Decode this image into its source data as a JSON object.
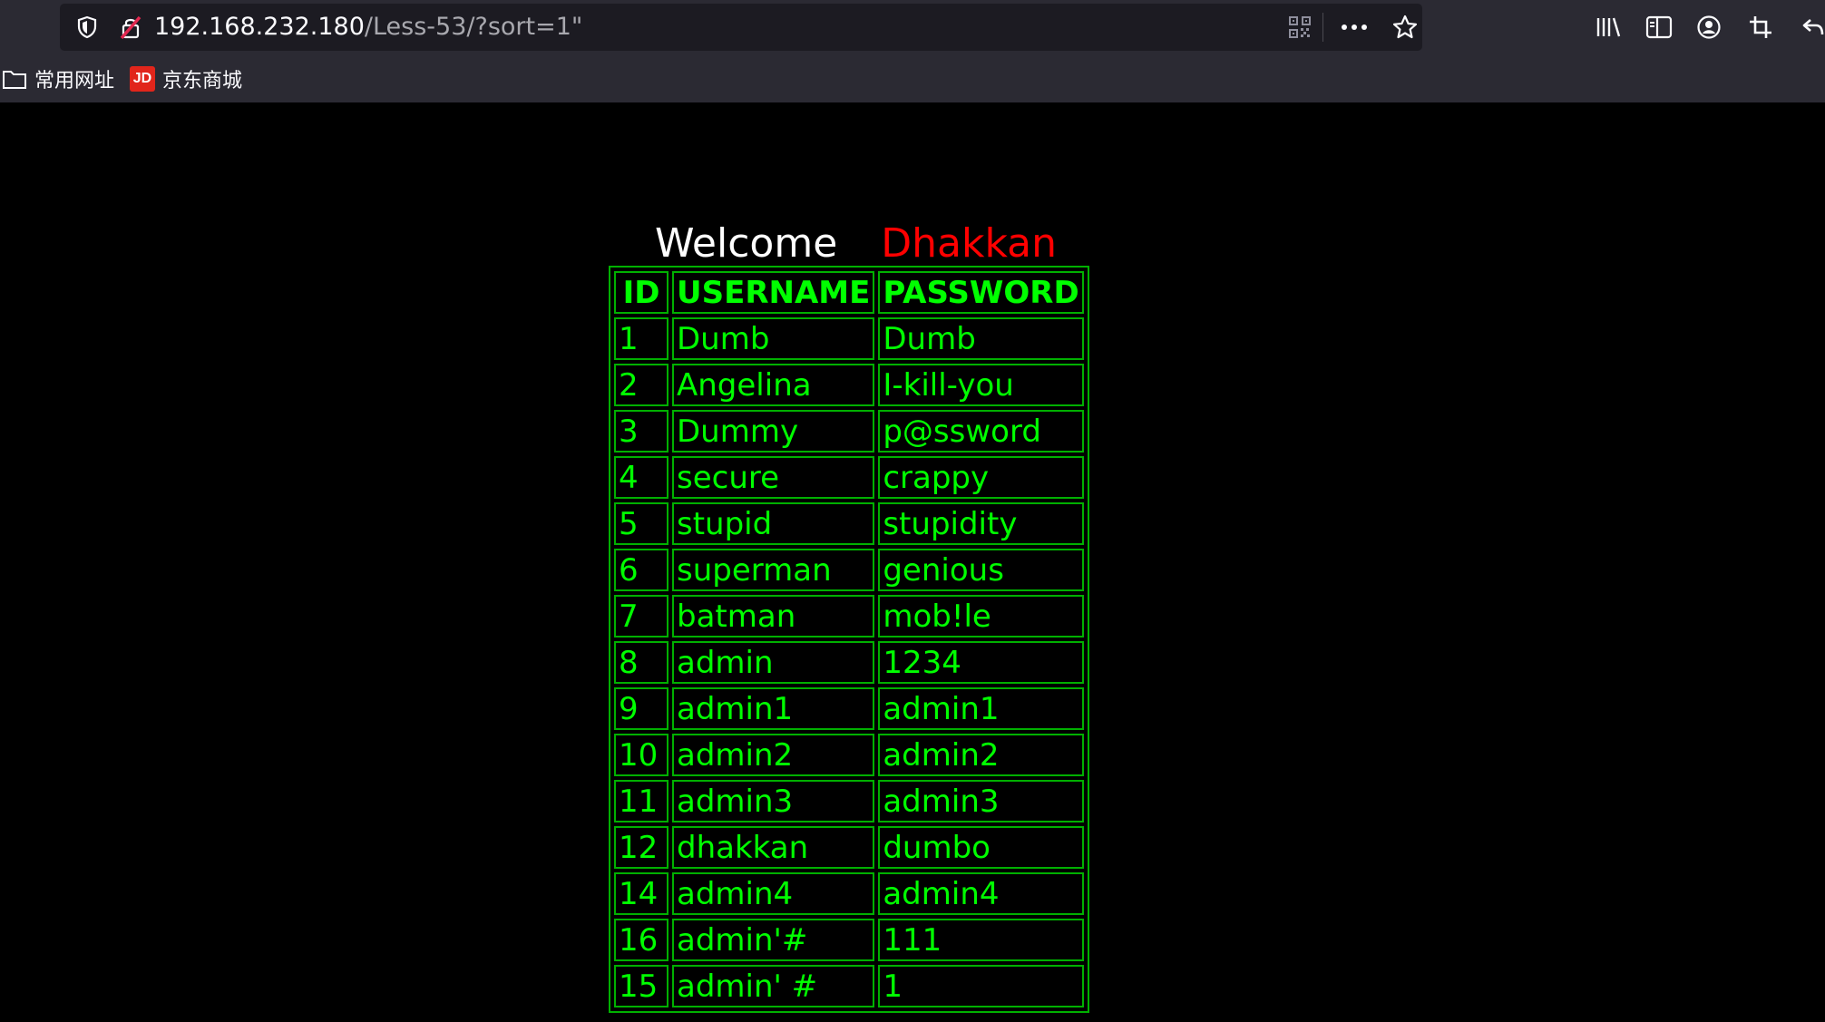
{
  "browser": {
    "url_host": "192.168.232.180",
    "url_path": "/Less-53/?sort=1\"",
    "icons": [
      "shield-icon",
      "insecure-lock-icon",
      "qr-code-icon",
      "more-icon",
      "star-icon",
      "library-icon",
      "sidebar-icon",
      "account-icon",
      "screenshot-icon",
      "back-icon"
    ]
  },
  "bookmarks": {
    "common_label": "常用网址",
    "jd_logo": "JD",
    "jd_label": "京东商城"
  },
  "page": {
    "welcome": "Welcome",
    "name": "Dhakkan",
    "colors": {
      "text": "#00ff00",
      "name": "#ff0000",
      "background": "#000000"
    },
    "table": {
      "headers": [
        "ID",
        "USERNAME",
        "PASSWORD"
      ],
      "rows": [
        [
          "1",
          "Dumb",
          "Dumb"
        ],
        [
          "2",
          "Angelina",
          "I-kill-you"
        ],
        [
          "3",
          "Dummy",
          "p@ssword"
        ],
        [
          "4",
          "secure",
          "crappy"
        ],
        [
          "5",
          "stupid",
          "stupidity"
        ],
        [
          "6",
          "superman",
          "genious"
        ],
        [
          "7",
          "batman",
          "mob!le"
        ],
        [
          "8",
          "admin",
          "1234"
        ],
        [
          "9",
          "admin1",
          "admin1"
        ],
        [
          "10",
          "admin2",
          "admin2"
        ],
        [
          "11",
          "admin3",
          "admin3"
        ],
        [
          "12",
          "dhakkan",
          "dumbo"
        ],
        [
          "14",
          "admin4",
          "admin4"
        ],
        [
          "16",
          "admin'#",
          "111"
        ],
        [
          "15",
          "admin' #",
          "1"
        ]
      ]
    }
  }
}
